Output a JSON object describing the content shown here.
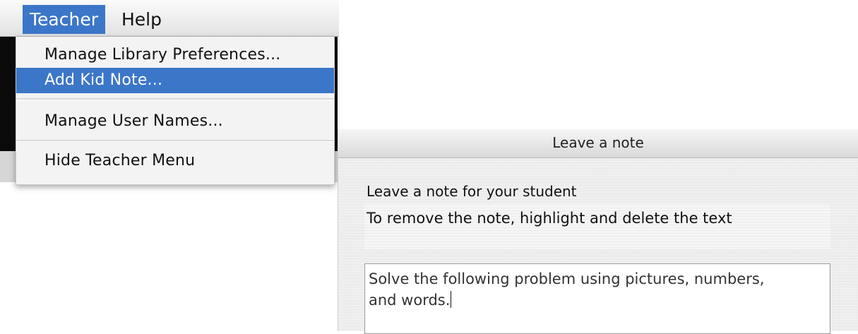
{
  "menubar": {
    "items": [
      {
        "label": "Teacher",
        "active": true
      },
      {
        "label": "Help",
        "active": false
      }
    ]
  },
  "teacher_menu": {
    "items": [
      {
        "label": "Manage Library Preferences...",
        "highlighted": false
      },
      {
        "label": "Add Kid Note...",
        "highlighted": true
      },
      {
        "label": "Manage User Names...",
        "highlighted": false
      },
      {
        "label": "Hide Teacher Menu",
        "highlighted": false
      }
    ],
    "highlight_color": "#3c76c8"
  },
  "dialog": {
    "title": "Leave a note",
    "instruction": "Leave a note for your student",
    "hint": "To remove the note, highlight and delete the text",
    "note_text": "Solve the following problem using pictures, numbers,\nand words."
  },
  "icons": {
    "text_caret": "text-caret-icon"
  }
}
